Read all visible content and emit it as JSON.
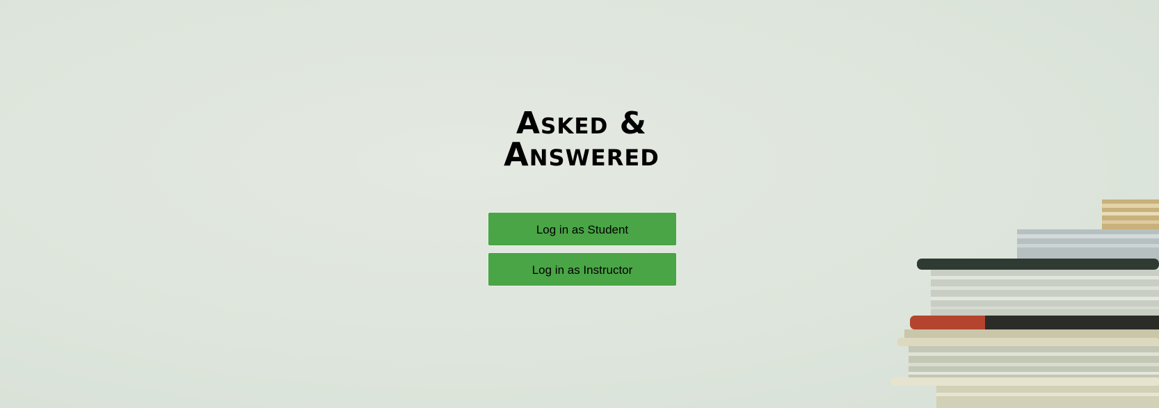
{
  "app": {
    "title_line1": "Asked &",
    "title_line2": "Answered"
  },
  "actions": {
    "student_login_label": "Log in as Student",
    "instructor_login_label": "Log in as Instructor"
  },
  "colors": {
    "button_bg": "#49a545",
    "background": "#e1e8df",
    "text": "#000000"
  }
}
